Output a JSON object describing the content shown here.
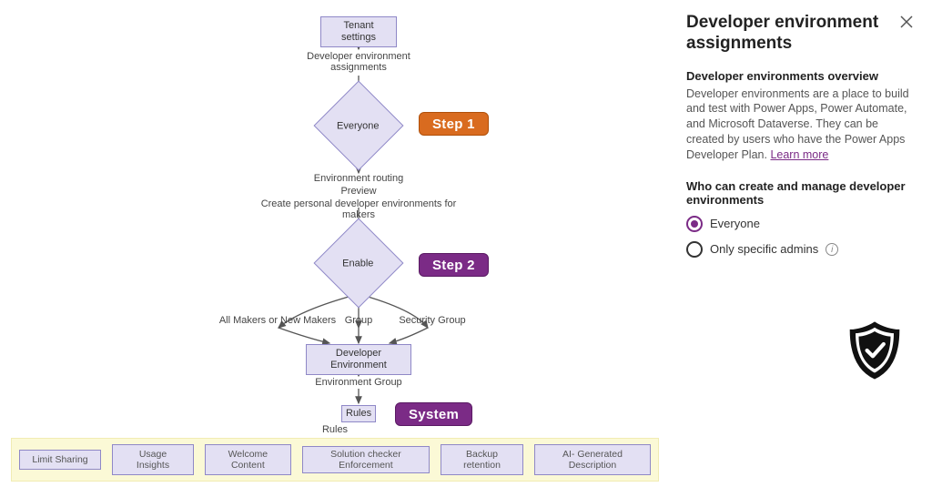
{
  "panel": {
    "title": "Developer environment assignments",
    "overview_head": "Developer environments overview",
    "overview_body": "Developer environments are a place to build and test with Power Apps, Power Automate, and Microsoft Dataverse. They can be created by users who have the Power Apps Developer Plan.",
    "learn_more": "Learn more",
    "who_head": "Who can create and manage developer environments",
    "option_everyone": "Everyone",
    "option_admins": "Only specific admins"
  },
  "callouts": {
    "step1": "Step 1",
    "step2": "Step 2",
    "system": "System"
  },
  "flow": {
    "tenant_settings": "Tenant settings",
    "dev_env_assignments": "Developer environment assignments",
    "everyone": "Everyone",
    "env_routing": "Environment routing",
    "preview": "Preview",
    "create_personal": "Create personal developer environments for makers",
    "enable": "Enable",
    "branch_left": "All Makers or New Makers",
    "branch_mid": "Group",
    "branch_right": "Security Group",
    "dev_environment": "Developer Environment",
    "env_group": "Environment Group",
    "rules_box": "Rules",
    "rules_title": "Rules"
  },
  "rules": [
    "Limit Sharing",
    "Usage Insights",
    "Welcome Content",
    "Solution checker Enforcement",
    "Backup retention",
    "AI- Generated Description"
  ]
}
